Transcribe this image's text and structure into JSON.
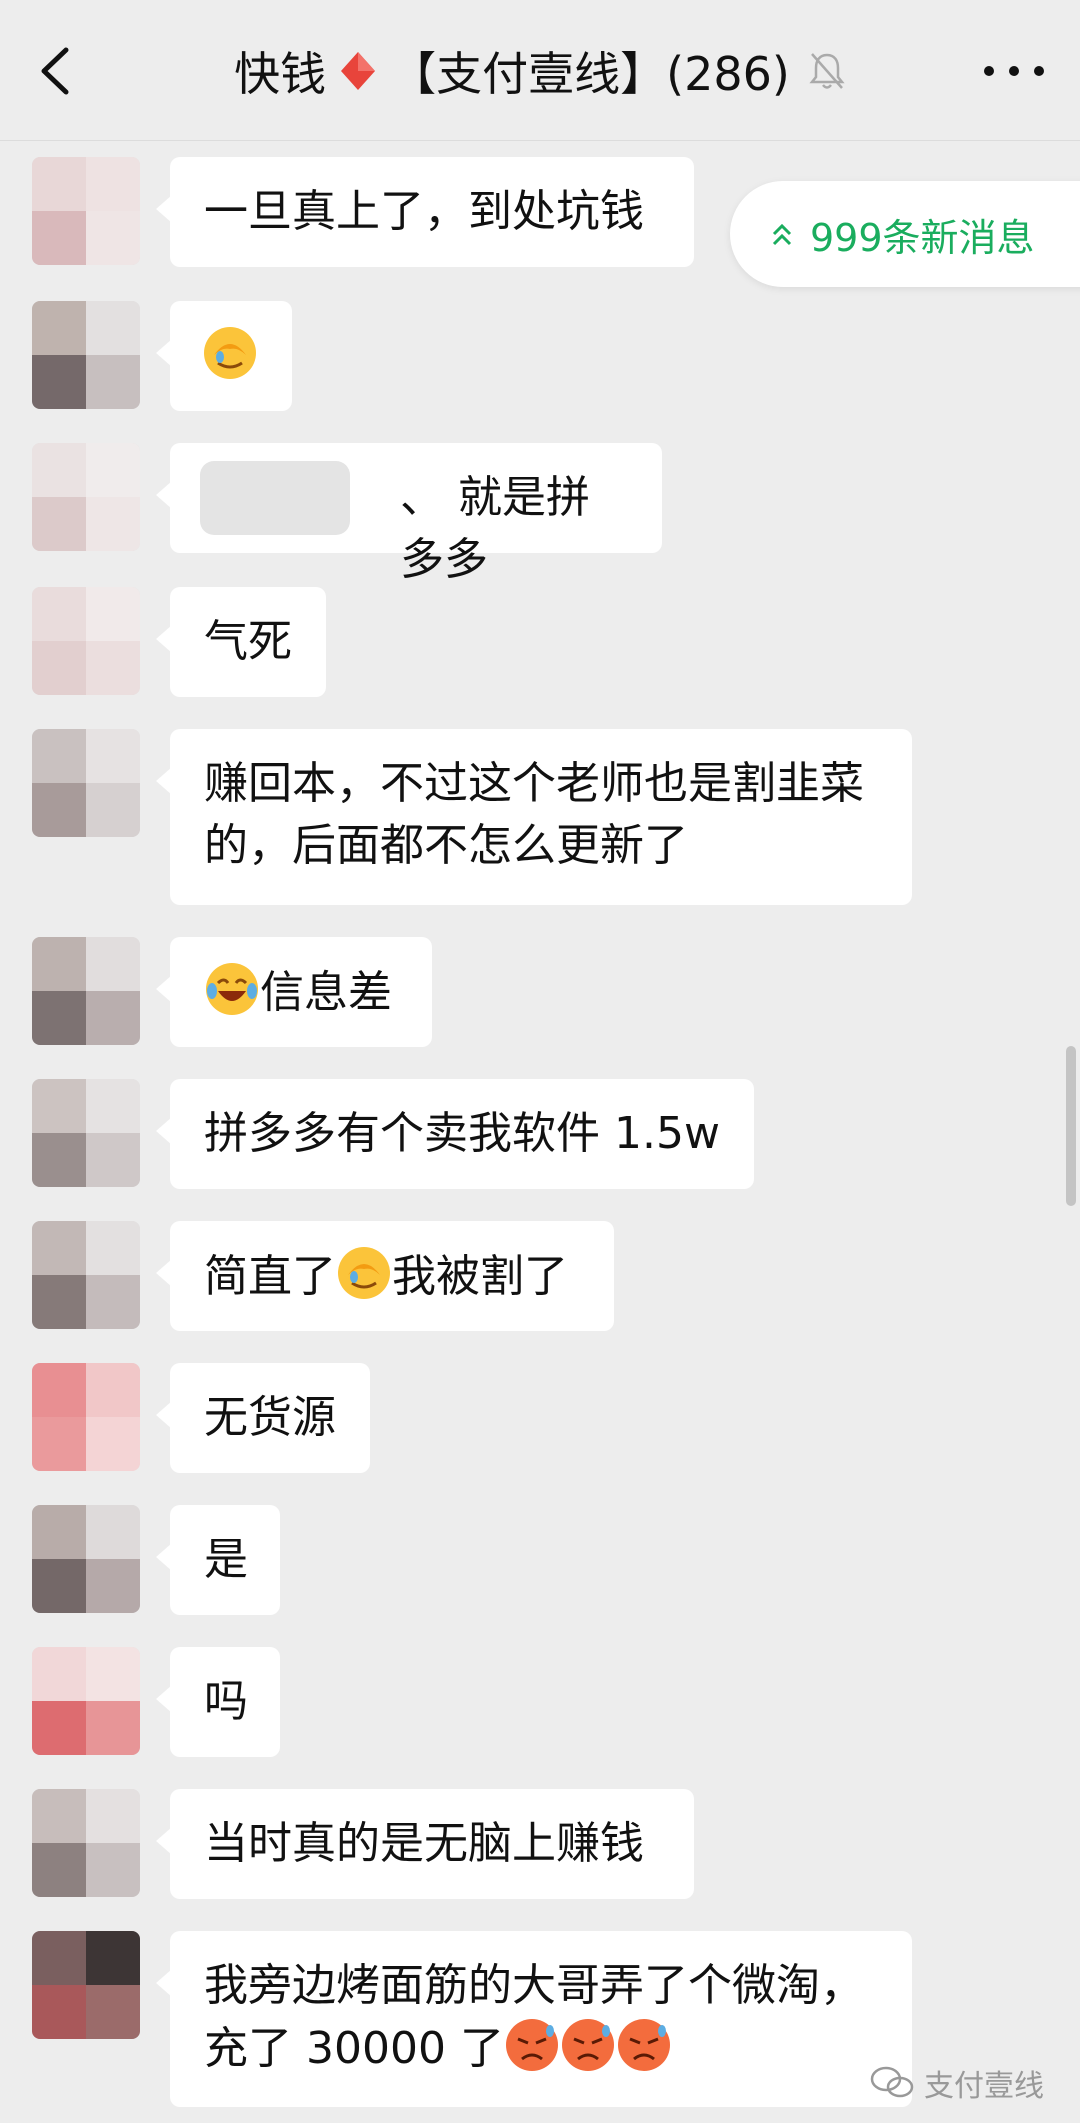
{
  "header": {
    "title_left": "快钱",
    "title_right": "【支付壹线】(286)",
    "muted": true
  },
  "new_messages": {
    "label": "999条新消息"
  },
  "messages": [
    {
      "text": "一旦真上了，到处坑钱"
    },
    {
      "text": "",
      "emoji": "facepalm"
    },
    {
      "text": "、  就是拼多多"
    },
    {
      "text": "气死"
    },
    {
      "line1": "赚回本，不过这个老师也是割韭菜",
      "line2": "的，后面都不怎么更新了"
    },
    {
      "text": "信息差",
      "emoji": "joy"
    },
    {
      "text": "拼多多有个卖我软件 1.5w"
    },
    {
      "before": "简直了",
      "after": "我被割了",
      "emoji": "facepalm"
    },
    {
      "text": "无货源"
    },
    {
      "text": "是"
    },
    {
      "text": "吗"
    },
    {
      "text": "当时真的是无脑上赚钱"
    },
    {
      "line1": "我旁边烤面筋的大哥弄了个微淘，",
      "line2": "充了 30000 了",
      "emoji": "angry-sweat"
    }
  ],
  "watermark": {
    "label": "支付壹线"
  },
  "colors": {
    "accent": "#1aad5e",
    "background": "#ededed",
    "bubble": "#ffffff"
  }
}
